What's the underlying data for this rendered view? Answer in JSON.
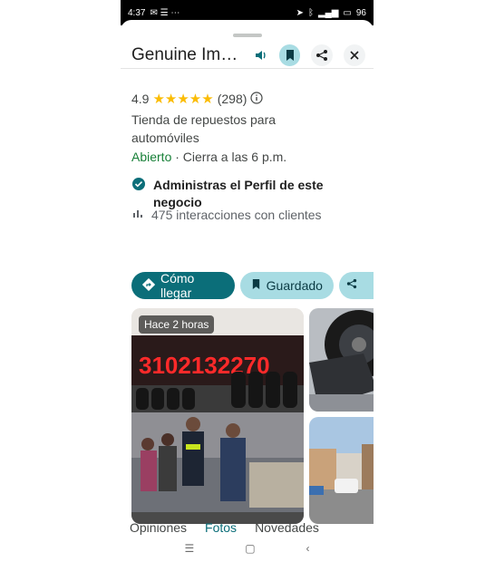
{
  "status": {
    "time": "4:37",
    "battery": "96"
  },
  "place": {
    "title": "Genuine Im…",
    "rating": "4.9",
    "reviews": "(298)",
    "category": "Tienda de repuestos para automóviles",
    "open_status": "Abierto",
    "hours": " · Cierra a las 6 p.m.",
    "manage_text": "Administras el Perfil de este negocio",
    "interactions": "475 interacciones con clientes"
  },
  "actions": {
    "directions": "Cómo llegar",
    "saved": "Guardado"
  },
  "photos": {
    "badge": "Hace 2 horas",
    "sign_number": "3102132270"
  },
  "tabs": [
    "Opiniones",
    "Fotos",
    "Novedades"
  ],
  "colors": {
    "accent": "#0b6e79",
    "soft": "#a8dce3",
    "stars": "#fbbc04",
    "open": "#188038"
  }
}
